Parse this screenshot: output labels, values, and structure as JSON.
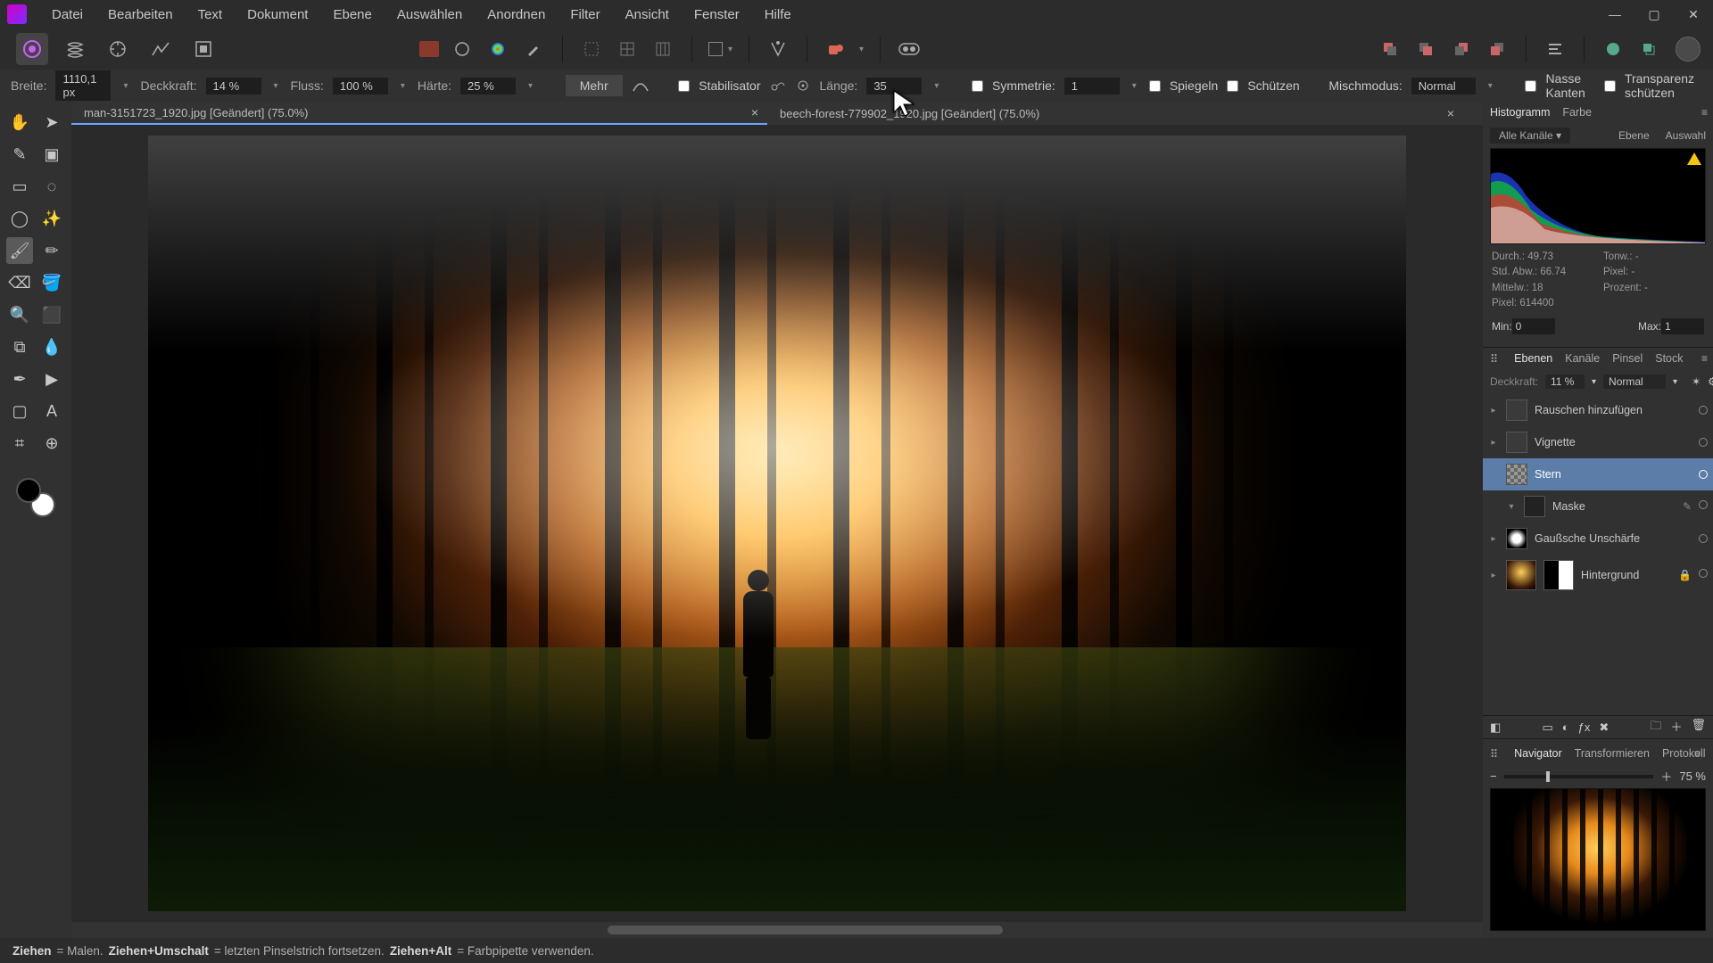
{
  "menu": [
    "Datei",
    "Bearbeiten",
    "Text",
    "Dokument",
    "Ebene",
    "Auswählen",
    "Anordnen",
    "Filter",
    "Ansicht",
    "Fenster",
    "Hilfe"
  ],
  "context": {
    "breite_l": "Breite:",
    "breite_v": "1110,1 px",
    "deckkraft_l": "Deckkraft:",
    "deckkraft_v": "14 %",
    "fluss_l": "Fluss:",
    "fluss_v": "100 %",
    "haerte_l": "Härte:",
    "haerte_v": "25 %",
    "mehr": "Mehr",
    "stabil": "Stabilisator",
    "laenge_l": "Länge:",
    "laenge_v": "35",
    "symm_l": "Symmetrie:",
    "symm_v": "1",
    "spiegeln": "Spiegeln",
    "schuetzen": "Schützen",
    "misch_l": "Mischmodus:",
    "misch_v": "Normal",
    "nasse": "Nasse Kanten",
    "transp": "Transparenz schützen"
  },
  "tabs": [
    "man-3151723_1920.jpg [Geändert] (75.0%)",
    "beech-forest-779902_1920.jpg [Geändert] (75.0%)"
  ],
  "histo": {
    "tab1": "Histogramm",
    "tab2": "Farbe",
    "channels": "Alle Kanäle",
    "ebene": "Ebene",
    "auswahl": "Auswahl",
    "durch": "Durch.: 49.73",
    "stdabw": "Std. Abw.: 66.74",
    "mittelw": "Mittelw.: 18",
    "pixel": "Pixel: 614400",
    "tonw": "Tonw.: -",
    "pixelr": "Pixel: -",
    "prozent": "Prozent: -",
    "min_l": "Min:",
    "min_v": "0",
    "max_l": "Max:",
    "max_v": "1"
  },
  "layers": {
    "t1": "Ebenen",
    "t2": "Kanäle",
    "t3": "Pinsel",
    "t4": "Stock",
    "op_l": "Deckkraft:",
    "op_v": "11 %",
    "blend": "Normal",
    "l1": "Rauschen hinzufügen",
    "l2": "Vignette",
    "l3": "Stern",
    "l4": "Maske",
    "l5": "Gaußsche Unschärfe",
    "l6": "Hintergrund"
  },
  "nav": {
    "t1": "Navigator",
    "t2": "Transformieren",
    "t3": "Protokoll",
    "zoom": "75 %"
  },
  "status": {
    "s1": "Ziehen",
    "s1d": " = Malen. ",
    "s2": "Ziehen+Umschalt",
    "s2d": " = letzten Pinselstrich fortsetzen. ",
    "s3": "Ziehen+Alt",
    "s3d": " = Farbpipette verwenden."
  }
}
